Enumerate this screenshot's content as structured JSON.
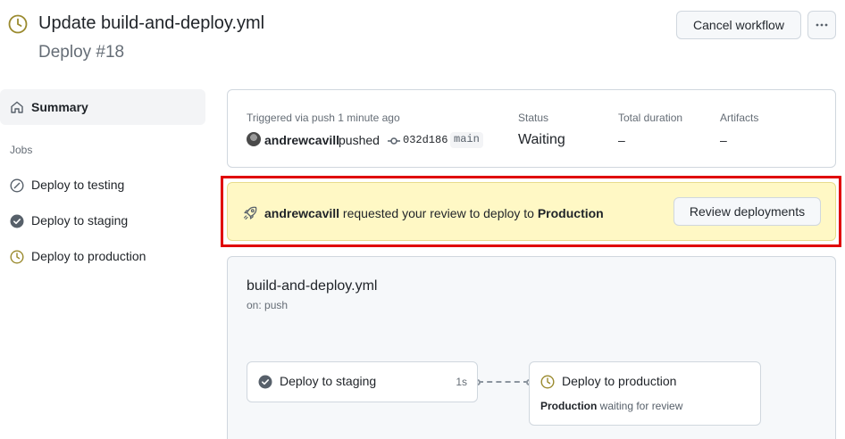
{
  "header": {
    "title": "Update build-and-deploy.yml",
    "subtitle": "Deploy #18",
    "cancel_label": "Cancel workflow",
    "status_icon": "clock-icon",
    "more_icon": "kebab-icon"
  },
  "sidebar": {
    "summary_label": "Summary",
    "jobs_heading": "Jobs",
    "jobs": [
      {
        "label": "Deploy to testing",
        "icon": "skipped-icon"
      },
      {
        "label": "Deploy to staging",
        "icon": "check-circle-icon"
      },
      {
        "label": "Deploy to production",
        "icon": "clock-icon"
      }
    ]
  },
  "run": {
    "trigger_label": "Triggered via push 1 minute ago",
    "user": "andrewcavill",
    "action": "pushed",
    "sha": "032d186",
    "branch": "main",
    "status_label": "Status",
    "status_value": "Waiting",
    "duration_label": "Total duration",
    "duration_value": "–",
    "artifacts_label": "Artifacts",
    "artifacts_value": "–"
  },
  "banner": {
    "user": "andrewcavill",
    "text": " requested your review to deploy to ",
    "environment": "Production",
    "button_label": "Review deployments"
  },
  "workflow": {
    "file": "build-and-deploy.yml",
    "trigger": "on: push",
    "nodes": [
      {
        "name": "Deploy to staging",
        "duration": "1s"
      },
      {
        "name": "Deploy to production",
        "env": "Production",
        "note": " waiting for review"
      }
    ]
  },
  "colors": {
    "waiting": "#9a8a2e",
    "success": "#57606a",
    "banner_bg": "#fff8c5",
    "highlight": "#e00000"
  }
}
